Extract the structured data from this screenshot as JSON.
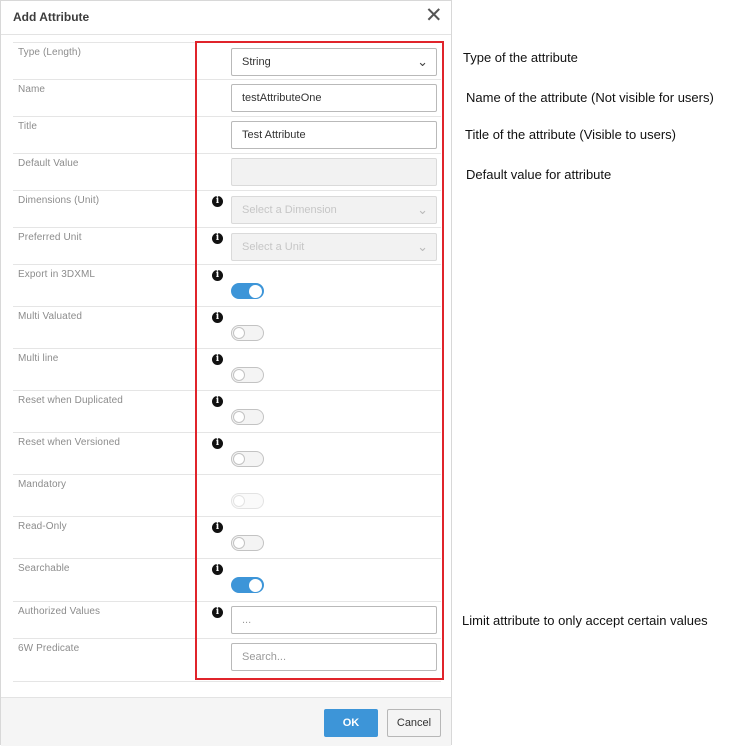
{
  "dialog": {
    "title": "Add Attribute",
    "close_icon": "close-icon",
    "info_icon": "info-icon",
    "fields": {
      "type": {
        "label": "Type (Length)",
        "value": "String"
      },
      "name": {
        "label": "Name",
        "value": "testAttributeOne"
      },
      "title": {
        "label": "Title",
        "value": "Test Attribute"
      },
      "default_value": {
        "label": "Default Value",
        "value": ""
      },
      "dimensions": {
        "label": "Dimensions (Unit)",
        "placeholder": "Select a Dimension"
      },
      "preferred_unit": {
        "label": "Preferred Unit",
        "placeholder": "Select a Unit"
      },
      "export_3dxml": {
        "label": "Export in 3DXML",
        "on": true
      },
      "multi_valuated": {
        "label": "Multi Valuated",
        "on": false
      },
      "multi_line": {
        "label": "Multi line",
        "on": false
      },
      "reset_duplicated": {
        "label": "Reset when Duplicated",
        "on": false
      },
      "reset_versioned": {
        "label": "Reset when Versioned",
        "on": false
      },
      "mandatory": {
        "label": "Mandatory",
        "on": false,
        "disabled": true
      },
      "read_only": {
        "label": "Read-Only",
        "on": false
      },
      "searchable": {
        "label": "Searchable",
        "on": true
      },
      "authorized_values": {
        "label": "Authorized Values",
        "placeholder": "..."
      },
      "predicate_6w": {
        "label": "6W Predicate",
        "placeholder": "Search..."
      }
    },
    "buttons": {
      "ok": "OK",
      "cancel": "Cancel"
    }
  },
  "annotations": {
    "type": "Type of the attribute",
    "name": "Name of the attribute (Not visible for users)",
    "title": "Title of the attribute (Visible to users)",
    "default_value": "Default value for attribute",
    "authorized_values": "Limit attribute to only accept certain values"
  },
  "colors": {
    "accent": "#3d95d8",
    "highlight": "#e0242b"
  }
}
